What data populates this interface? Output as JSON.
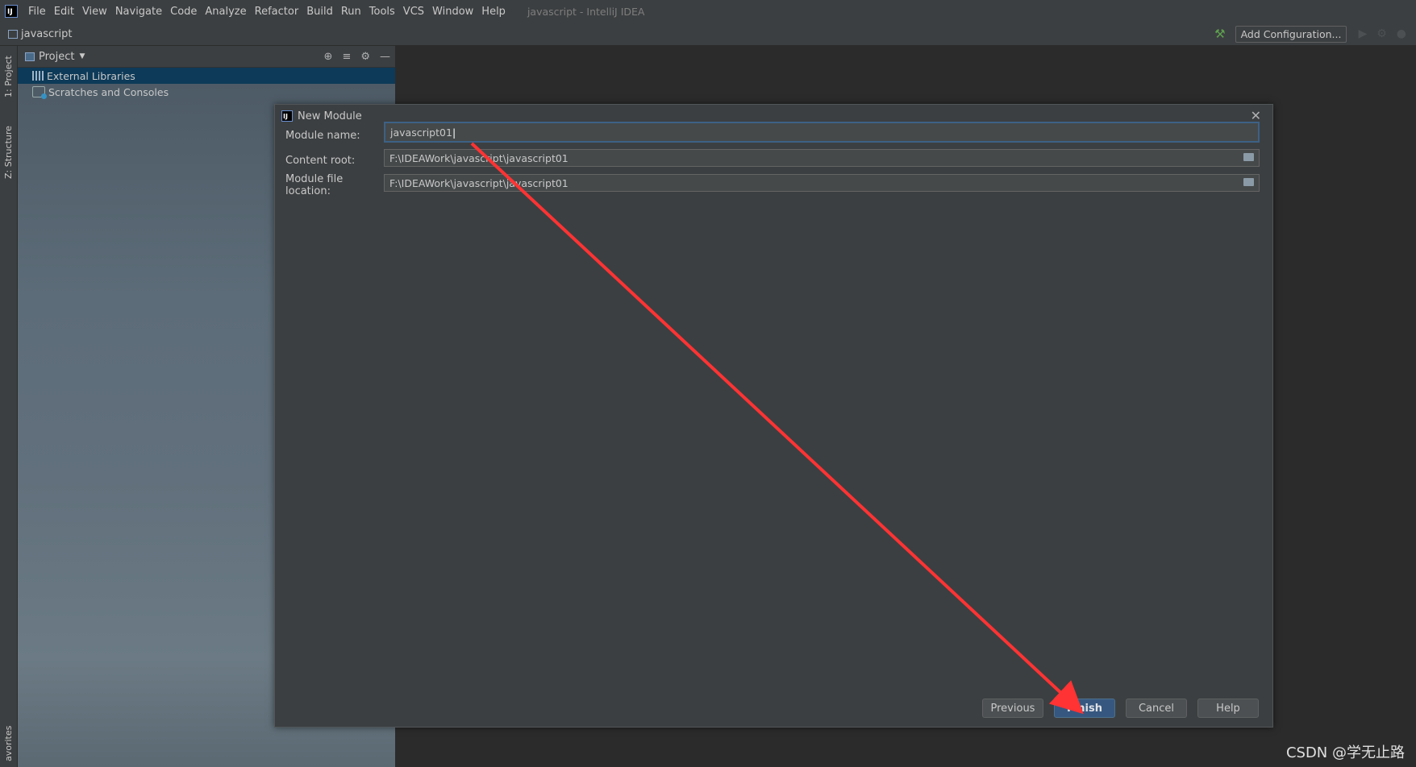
{
  "menubar": {
    "items": [
      "File",
      "Edit",
      "View",
      "Navigate",
      "Code",
      "Analyze",
      "Refactor",
      "Build",
      "Run",
      "Tools",
      "VCS",
      "Window",
      "Help"
    ],
    "window_title": "javascript - IntelliJ IDEA"
  },
  "navbar": {
    "project_name": "javascript",
    "add_configuration_label": "Add Configuration..."
  },
  "left_stripe": {
    "project_tab": "1: Project",
    "structure_tab": "Z: Structure",
    "favorites_tab": "avorites"
  },
  "project_panel": {
    "title": "Project",
    "tree_items": [
      {
        "label": "External Libraries",
        "selected": true,
        "icon": "library-icon"
      },
      {
        "label": "Scratches and Consoles",
        "selected": false,
        "icon": "scratches-icon"
      }
    ]
  },
  "dialog": {
    "title": "New Module",
    "module_name_label": "Module name:",
    "module_name_value": "javascript01",
    "content_root_label": "Content root:",
    "content_root_value": "F:\\IDEAWork\\javascript\\javascript01",
    "module_file_location_label": "Module file location:",
    "module_file_location_value": "F:\\IDEAWork\\javascript\\javascript01",
    "buttons": {
      "previous": "Previous",
      "finish": "Finish",
      "cancel": "Cancel",
      "help": "Help"
    }
  },
  "watermark": "CSDN @学无止路",
  "colors": {
    "background": "#2b2b2b",
    "panel": "#3c3f41",
    "selection": "#0d3a58",
    "primary_button": "#365880",
    "annotation_arrow": "#ff3333"
  }
}
